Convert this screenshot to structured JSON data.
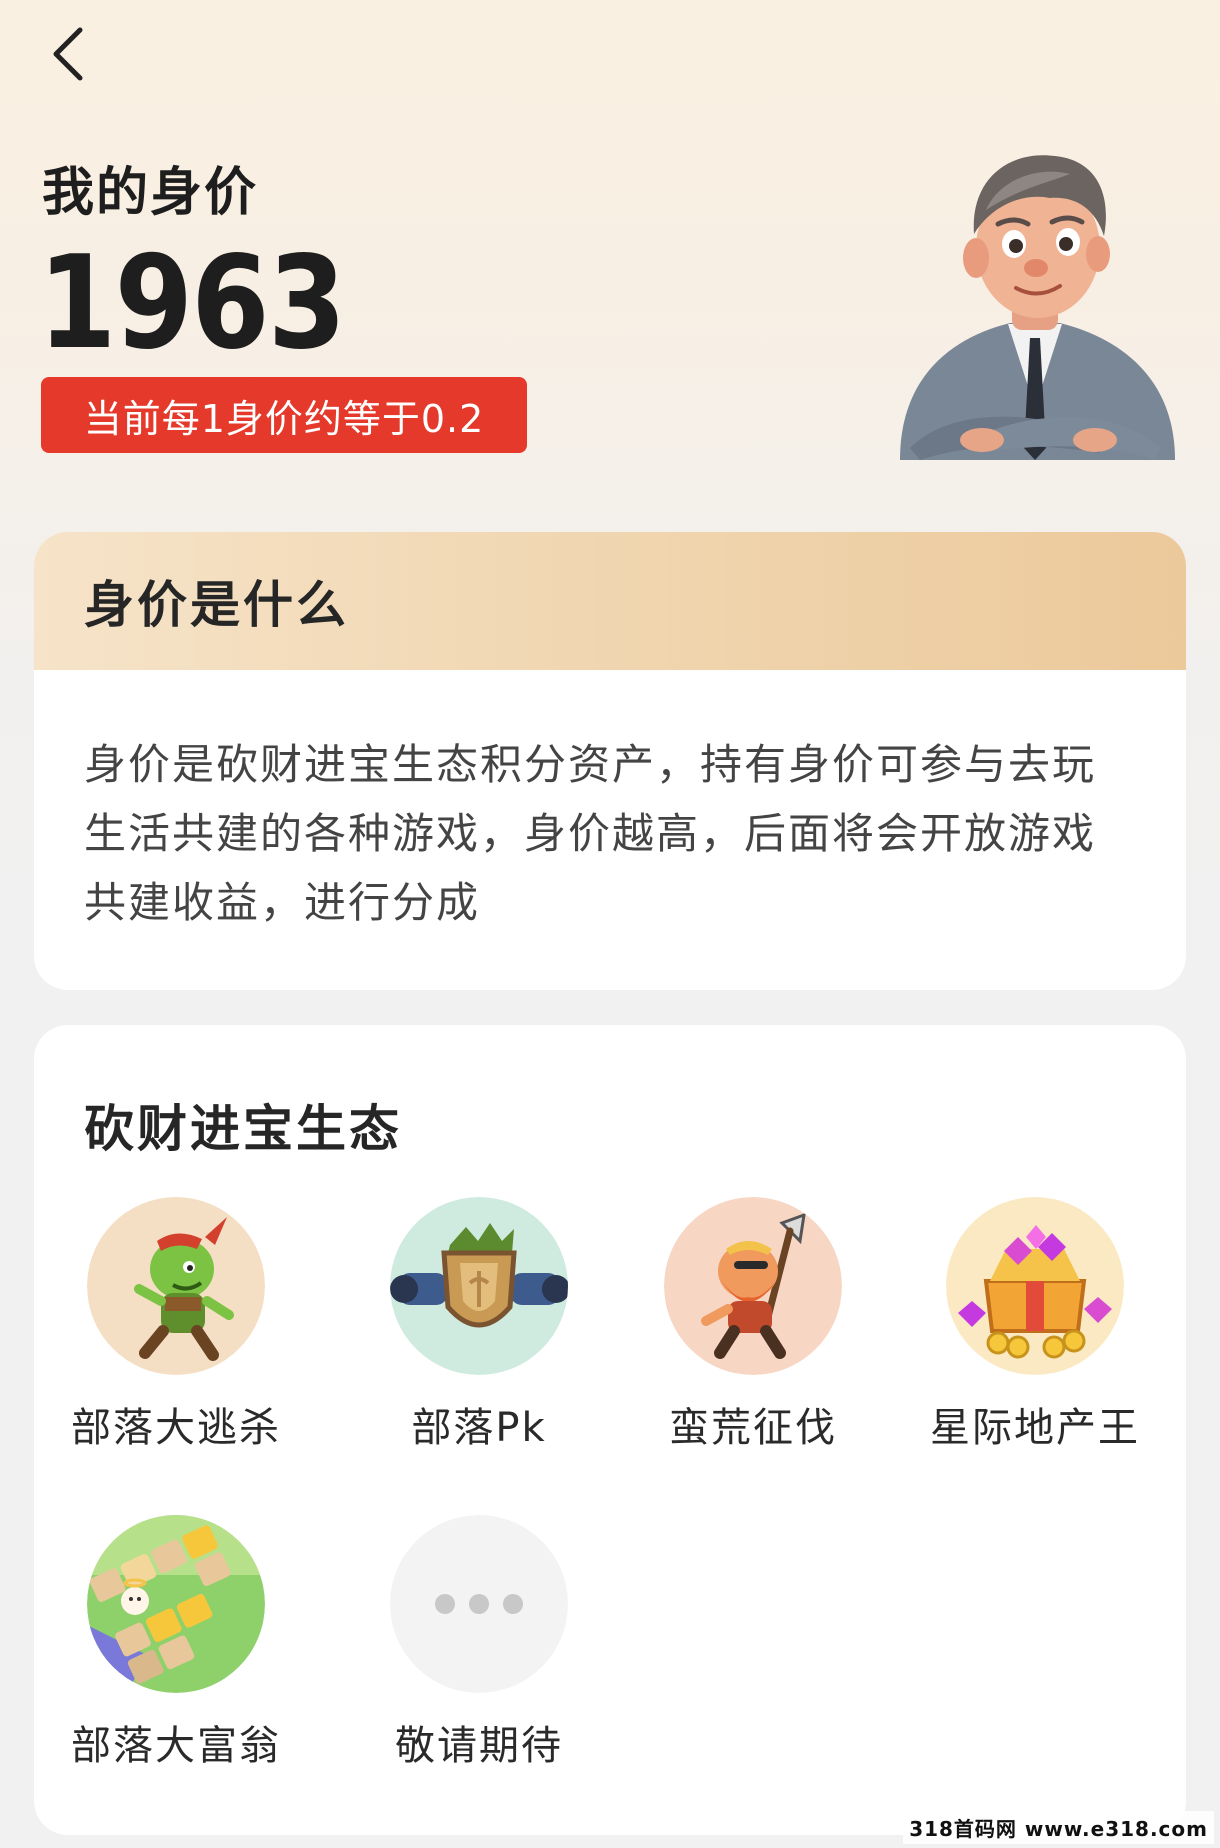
{
  "header": {
    "title": "我的身价",
    "value": "1963",
    "rate_text": "当前每1身价约等于0.2"
  },
  "intro": {
    "title": "身价是什么",
    "body": "身价是砍财进宝生态积分资产，持有身价可参与去玩生活共建的各种游戏，身价越高，后面将会开放游戏共建收益，进行分成"
  },
  "ecosystem": {
    "title": "砍财进宝生态",
    "games": [
      {
        "label": "部落大逃杀",
        "icon": "goblin-runner-icon"
      },
      {
        "label": "部落Pk",
        "icon": "shield-cannon-icon"
      },
      {
        "label": "蛮荒征伐",
        "icon": "dwarf-axe-icon"
      },
      {
        "label": "星际地产王",
        "icon": "treasure-chest-icon"
      },
      {
        "label": "部落大富翁",
        "icon": "board-game-icon"
      },
      {
        "label": "敬请期待",
        "icon": "more-dots-icon"
      }
    ]
  },
  "watermark": "318首码网 www.e318.com",
  "colors": {
    "accent_red": "#e53a2b",
    "card_head_gold": "#f0d6b0"
  }
}
